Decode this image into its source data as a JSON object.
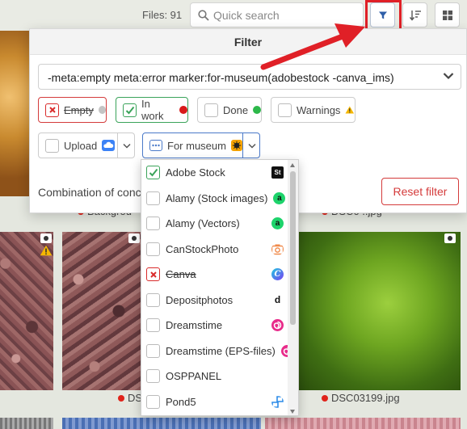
{
  "topbar": {
    "files_label": "Files: 91",
    "search_placeholder": "Quick search",
    "filter_icon": "filter-icon",
    "sort_icon": "sort-icon",
    "grid_icon": "grid-view-icon"
  },
  "gallery": {
    "captions": [
      {
        "name": "Backgrou",
        "status_color": "#e0241b"
      },
      {
        "name": "DSC0 ..jpg",
        "status_color": "#e0241b"
      },
      {
        "name": "DSC",
        "status_color": "#e0241b"
      },
      {
        "name": "DSC03199.jpg",
        "status_color": "#e0241b"
      }
    ]
  },
  "filter": {
    "title": "Filter",
    "query": "-meta:empty meta:error marker:for-museum(adobestock -canva_ims)",
    "chips": {
      "empty": {
        "label": "Empty",
        "state": "excluded",
        "dot_color": "#c4c4c4"
      },
      "in_work": {
        "label": "In work",
        "state": "checked",
        "dot_color": "#d81b1b"
      },
      "done": {
        "label": "Done",
        "state": "unchecked",
        "dot_color": "#2db84a"
      },
      "warnings": {
        "label": "Warnings",
        "state": "unchecked",
        "icon": "warning-icon"
      },
      "upload": {
        "label": "Upload",
        "state": "unchecked",
        "icon": "cloud-upload-icon"
      },
      "for_museum": {
        "label": "For museum",
        "icon": "museum-marker-icon"
      }
    },
    "combination_label": "Combination of conc",
    "reset_label": "Reset filter"
  },
  "dropdown": {
    "items": [
      {
        "label": "Adobe Stock",
        "state": "checked",
        "logo": "St"
      },
      {
        "label": "Alamy (Stock images)",
        "state": "unchecked",
        "logo": "a"
      },
      {
        "label": "Alamy (Vectors)",
        "state": "unchecked",
        "logo": "a"
      },
      {
        "label": "CanStockPhoto",
        "state": "unchecked",
        "logo": "camera"
      },
      {
        "label": "Canva",
        "state": "excluded",
        "logo": "C"
      },
      {
        "label": "Depositphotos",
        "state": "unchecked",
        "logo": "d"
      },
      {
        "label": "Dreamstime",
        "state": "unchecked",
        "logo": "spiral"
      },
      {
        "label": "Dreamstime (EPS-files)",
        "state": "unchecked",
        "logo": "spiral"
      },
      {
        "label": "OSPPANEL",
        "state": "unchecked",
        "logo": ""
      },
      {
        "label": "Pond5",
        "state": "unchecked",
        "logo": "p5"
      }
    ]
  },
  "colors": {
    "accent_red": "#e02027",
    "checked_green": "#3aa35a",
    "excluded_red": "#d43b3b",
    "museum_blue": "#4b7ac9"
  }
}
